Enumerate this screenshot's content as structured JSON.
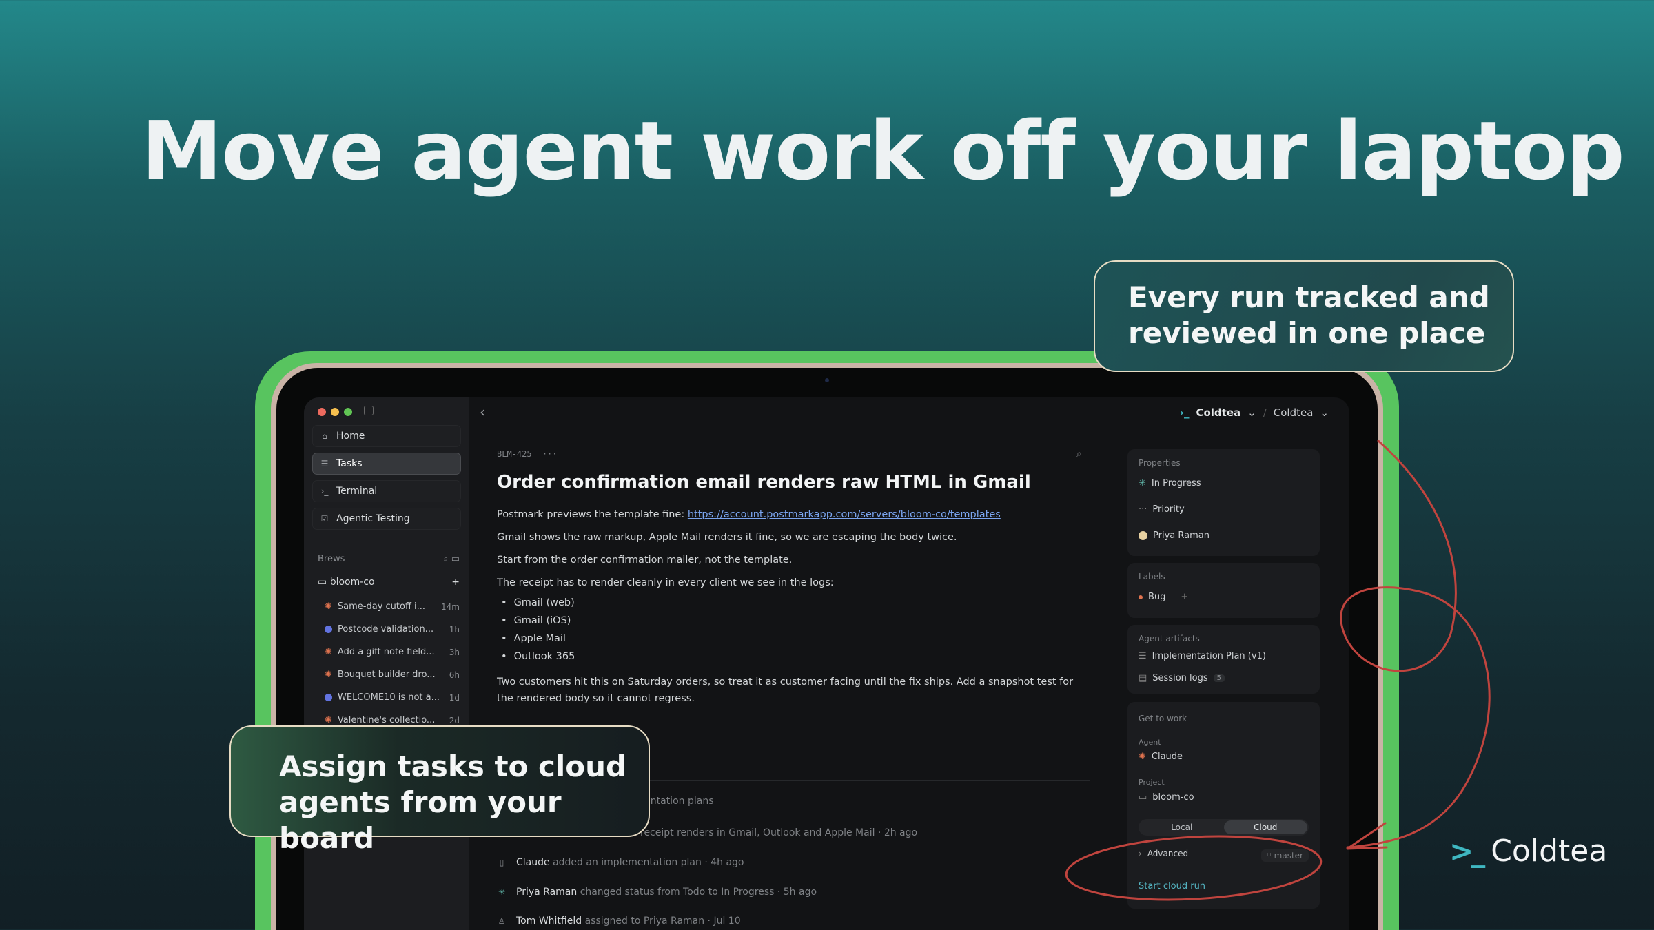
{
  "headline": "Move agent work off your laptop",
  "callouts": {
    "top": [
      "Every run tracked and",
      "reviewed in one place"
    ],
    "bottom": [
      "Assign tasks to cloud",
      "agents from your board"
    ]
  },
  "logo": {
    "mark": ">_",
    "name": "Coldtea"
  },
  "colors": {
    "accent_green": "#58c45f",
    "annotation_red": "#c0443e",
    "link_blue": "#7aa4ee",
    "cloud_run_teal": "#55b6c4"
  },
  "sidebar": {
    "nav": [
      {
        "label": "Home",
        "icon": "home-icon"
      },
      {
        "label": "Tasks",
        "icon": "tasks-icon"
      },
      {
        "label": "Terminal",
        "icon": "terminal-icon"
      },
      {
        "label": "Agentic Testing",
        "icon": "checkbox-icon"
      }
    ],
    "brews_label": "Brews",
    "folder": "bloom-co",
    "tasks": [
      {
        "title": "Same-day cutoff i...",
        "age": "14m",
        "icon": "burst-icon"
      },
      {
        "title": "Postcode validation...",
        "age": "1h",
        "icon": "ball-icon"
      },
      {
        "title": "Add a gift note field...",
        "age": "3h",
        "icon": "burst-icon"
      },
      {
        "title": "Bouquet builder dro...",
        "age": "6h",
        "icon": "burst-icon"
      },
      {
        "title": "WELCOME10 is not a...",
        "age": "1d",
        "icon": "ball-icon"
      },
      {
        "title": "Valentine's collectio...",
        "age": "2d",
        "icon": "burst-icon"
      }
    ]
  },
  "topbar": {
    "workspace": "Coldtea",
    "org": "Coldtea"
  },
  "issue": {
    "id": "BLM-425",
    "more": "···",
    "title": "Order confirmation email renders raw HTML in Gmail",
    "p1_prefix": "Postmark previews the template fine: ",
    "p1_link": "https://account.postmarkapp.com/servers/bloom-co/templates",
    "p2": "Gmail shows the raw markup, Apple Mail renders it fine, so we are escaping the body twice.",
    "p3": "Start from the order confirmation mailer, not the template.",
    "p4": "The receipt has to render cleanly in every client we see in the logs:",
    "bullets": [
      "Gmail (web)",
      "Gmail (iOS)",
      "Apple Mail",
      "Outlook 365"
    ],
    "p5": "Two customers hit this on Saturday orders, so treat it as customer facing until the fix ships. Add a snapshot test for the rendered body so it cannot regress."
  },
  "activity": [
    {
      "who": "",
      "text": "lementation plans"
    },
    {
      "who": "",
      "text": "receipt renders in Gmail, Outlook and Apple Mail · 2h ago"
    },
    {
      "who": "Claude",
      "text": " added an implementation plan · 4h ago",
      "icon": "doc-icon"
    },
    {
      "who": "Priya Raman",
      "text": " changed status from Todo to In Progress · 5h ago",
      "icon": "progress-icon"
    },
    {
      "who": "Tom Whitfield",
      "text": " assigned to Priya Raman · Jul 10",
      "icon": "person-icon"
    }
  ],
  "panel": {
    "properties_label": "Properties",
    "status": "In Progress",
    "priority": "Priority",
    "assignee": "Priya Raman",
    "labels_label": "Labels",
    "label_bug": "Bug",
    "artifacts_label": "Agent artifacts",
    "artifact_plan": "Implementation Plan (v1)",
    "artifact_logs": "Session logs",
    "artifact_logs_count": "5",
    "work_label": "Get to work",
    "agent_label": "Agent",
    "agent": "Claude",
    "project_label": "Project",
    "project": "bloom-co",
    "seg_local": "Local",
    "seg_cloud": "Cloud",
    "advanced": "Advanced",
    "branch": "master",
    "start": "Start cloud run"
  }
}
